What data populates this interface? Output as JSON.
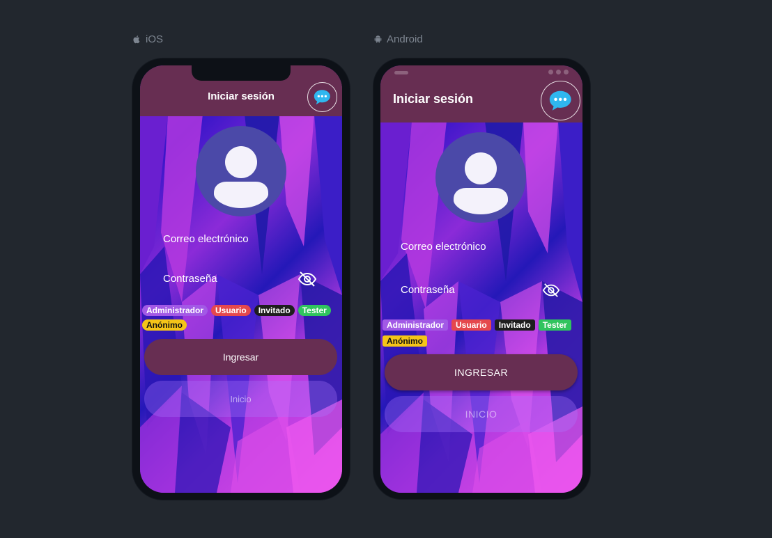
{
  "ios": {
    "platform_label": "iOS",
    "header": {
      "title": "Iniciar sesión"
    },
    "form": {
      "email_label": "Correo electrónico",
      "password_label": "Contraseña"
    },
    "roles": [
      {
        "label": "Administrador",
        "bg": "#a259e6",
        "fg": "#ffffff"
      },
      {
        "label": "Usuario",
        "bg": "#e5484d",
        "fg": "#ffffff"
      },
      {
        "label": "Invitado",
        "bg": "#1e1e1e",
        "fg": "#ffffff"
      },
      {
        "label": "Tester",
        "bg": "#30c45e",
        "fg": "#ffffff"
      },
      {
        "label": "Anónimo",
        "bg": "#f5c518",
        "fg": "#111111"
      }
    ],
    "buttons": {
      "primary": "Ingresar",
      "secondary": "Inicio"
    }
  },
  "android": {
    "platform_label": "Android",
    "header": {
      "title": "Iniciar sesión"
    },
    "form": {
      "email_label": "Correo electrónico",
      "password_label": "Contraseña"
    },
    "roles": [
      {
        "label": "Administrador",
        "bg": "#a259e6",
        "fg": "#ffffff"
      },
      {
        "label": "Usuario",
        "bg": "#e5484d",
        "fg": "#ffffff"
      },
      {
        "label": "Invitado",
        "bg": "#1e1e1e",
        "fg": "#ffffff"
      },
      {
        "label": "Tester",
        "bg": "#30c45e",
        "fg": "#ffffff"
      },
      {
        "label": "Anónimo",
        "bg": "#f5c518",
        "fg": "#111111"
      }
    ],
    "buttons": {
      "primary": "INGRESAR",
      "secondary": "INICIO"
    }
  },
  "icons": {
    "platform_ios": "apple-icon",
    "platform_android": "android-icon",
    "chat": "chat-bubble-icon",
    "avatar": "user-avatar-icon",
    "password_toggle": "eye-off-icon"
  },
  "colors": {
    "page_bg": "#22272e",
    "header_bg": "#672e52",
    "avatar_bg": "#4b49a8",
    "chat_icon": "#2fb7ef"
  }
}
